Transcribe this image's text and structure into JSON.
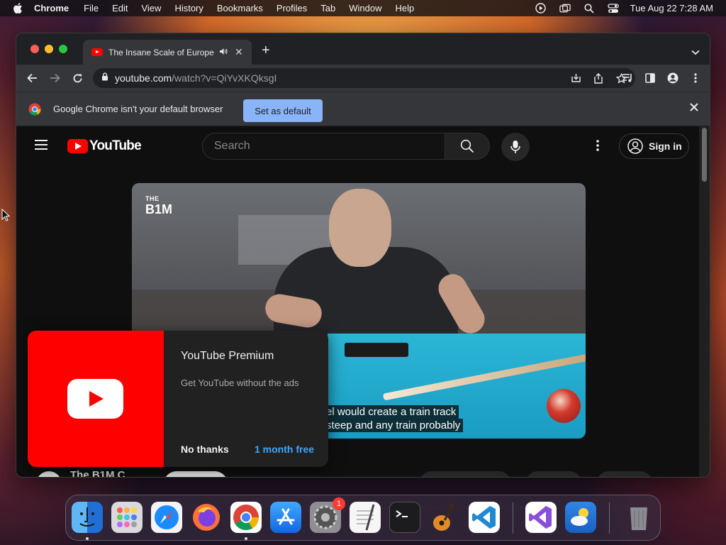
{
  "menubar": {
    "app_name": "Chrome",
    "items": [
      "File",
      "Edit",
      "View",
      "History",
      "Bookmarks",
      "Profiles",
      "Tab",
      "Window",
      "Help"
    ],
    "clock": "Tue Aug 22  7:28 AM",
    "status_icons": [
      "play-circle-icon",
      "screen-mirror-icon",
      "spotlight-icon",
      "control-center-icon"
    ]
  },
  "browser": {
    "tab_title": "The Insane Scale of Europe",
    "tab_audio_icon": "speaker-icon",
    "new_tab_label": "+",
    "url_host": "youtube.com",
    "url_path": "/watch?v=QiYvXKQksgI",
    "infobar": {
      "message": "Google Chrome isn't your default browser",
      "button_label": "Set as default"
    }
  },
  "youtube": {
    "logo_text": "YouTube",
    "search_placeholder": "Search",
    "signin_label": "Sign in",
    "video": {
      "channel_watermark_top": "THE",
      "channel_watermark_bottom": "B1M",
      "caption_line1": "el would create a train track",
      "caption_line2": "steep and any train probably"
    },
    "channel_name": "The B1M C",
    "premium_popup": {
      "title": "YouTube Premium",
      "description": "Get YouTube without the ads",
      "dismiss_label": "No thanks",
      "cta_label": "1 month free"
    }
  },
  "dock": {
    "apps": [
      {
        "name": "Finder",
        "icon": "finder-icon",
        "running": true
      },
      {
        "name": "Launchpad",
        "icon": "launchpad-icon",
        "running": false
      },
      {
        "name": "Safari",
        "icon": "safari-icon",
        "running": false
      },
      {
        "name": "Firefox",
        "icon": "firefox-icon",
        "running": false
      },
      {
        "name": "Chrome",
        "icon": "chrome-icon",
        "running": true
      },
      {
        "name": "App Store",
        "icon": "app-store-icon",
        "running": false
      },
      {
        "name": "System Settings",
        "icon": "system-settings-icon",
        "running": false,
        "badge": "1"
      },
      {
        "name": "TextEdit",
        "icon": "textedit-icon",
        "running": false
      },
      {
        "name": "Terminal",
        "icon": "terminal-icon",
        "running": false
      },
      {
        "name": "GarageBand",
        "icon": "garageband-icon",
        "running": false
      },
      {
        "name": "VS Code",
        "icon": "vscode-icon",
        "running": false
      },
      {
        "name": "Visual Studio",
        "icon": "visual-studio-icon",
        "running": false
      },
      {
        "name": "Weather",
        "icon": "weather-icon",
        "running": false
      },
      {
        "name": "Trash",
        "icon": "trash-icon",
        "running": false
      }
    ],
    "settings_badge": "1"
  },
  "colors": {
    "youtube_red": "#ff0000",
    "chrome_accent": "#8ab4f8",
    "link_blue": "#3ea6ff"
  }
}
